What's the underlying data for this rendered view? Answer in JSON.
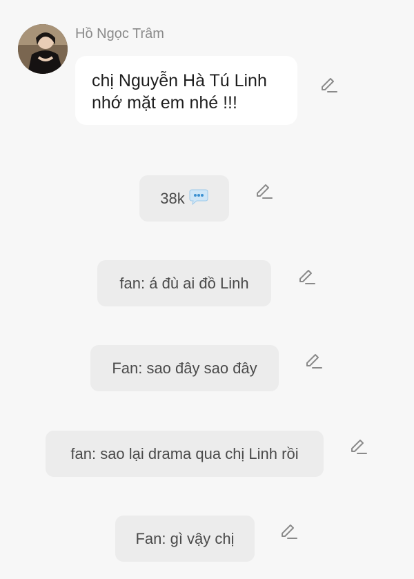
{
  "sender": {
    "name": "Hồ Ngọc Trâm"
  },
  "message": {
    "lines": [
      "chị Nguyễn Hà Tú Linh",
      "nhớ mặt em nhé !!!"
    ]
  },
  "reaction_chip": {
    "count": "38k",
    "icon": "speech-bubble-icon"
  },
  "comments": [
    "fan: á đù ai đồ Linh",
    "Fan: sao đây sao đây",
    "fan: sao lại drama qua chị Linh rồi",
    "Fan: gì vậy chị"
  ],
  "icons": {
    "edit": "pencil-edit-icon"
  },
  "colors": {
    "background": "#f7f7f7",
    "bubble": "#ffffff",
    "chip": "#ececec",
    "icon": "#8a8a8a"
  }
}
